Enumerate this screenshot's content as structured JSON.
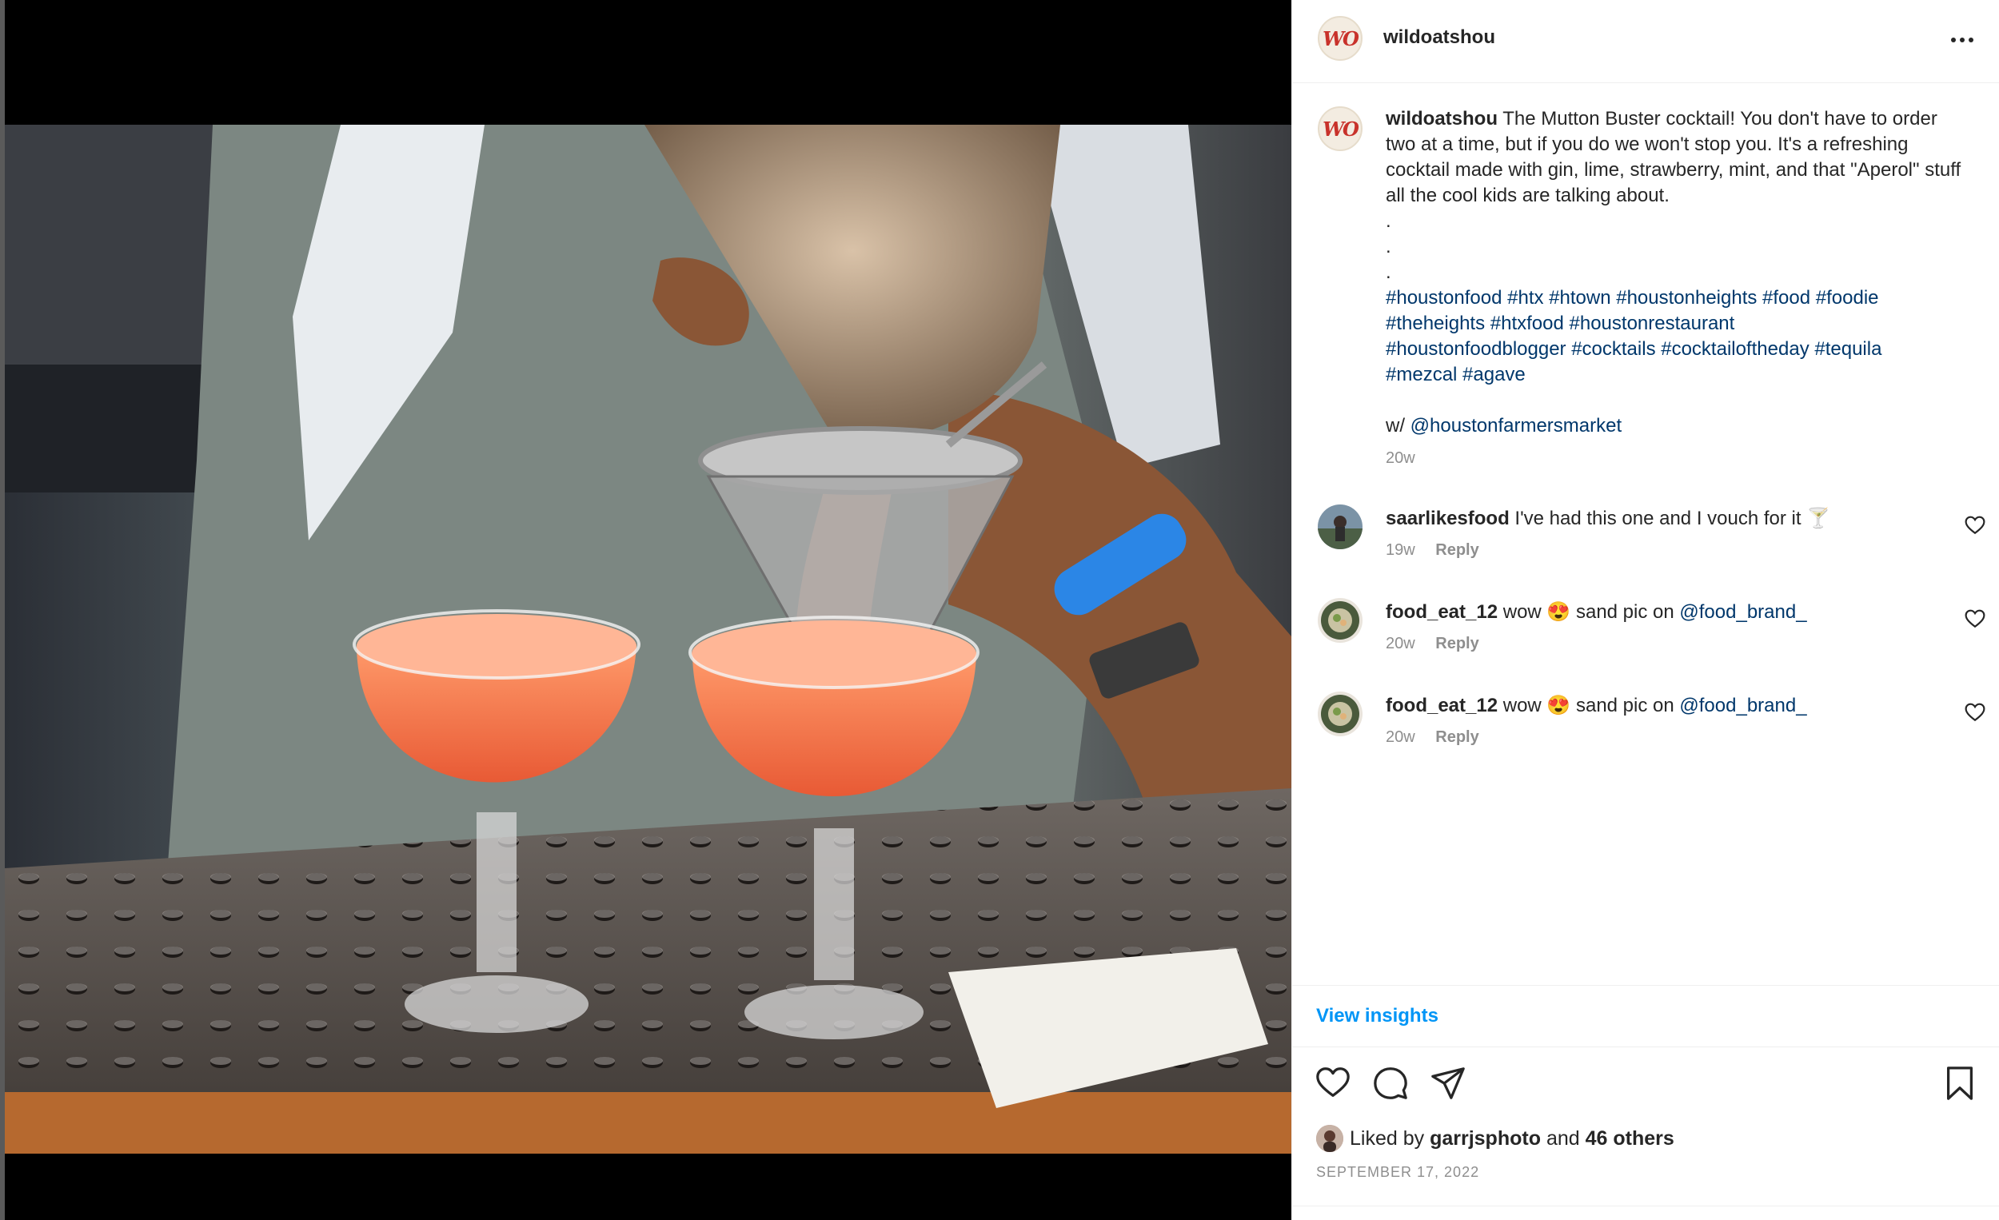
{
  "post": {
    "author": "wildoatshou",
    "avatar_monogram": "WO"
  },
  "caption": {
    "username": "wildoatshou",
    "text": "The Mutton Buster cocktail! You don't have to order two at a time, but if you do we won't stop you. It's a refreshing cocktail made with gin, lime, strawberry, mint, and that \"Aperol\" stuff all the cool kids are talking about.",
    "dots": [
      ".",
      ".",
      "."
    ],
    "hashtags_line1": "#houstonfood #htx #htown #houstonheights #food #foodie",
    "hashtags_line2": "#theheights #htxfood #houstonrestaurant",
    "hashtags_line3": "#houstonfoodblogger #cocktails #cocktailoftheday #tequila",
    "hashtags_line4": "#mezcal #agave",
    "with_prefix": "w/",
    "with_mention": "@houstonfarmersmarket",
    "time": "20w"
  },
  "comments": [
    {
      "username": "saarlikesfood",
      "text": "I've had this one and I vouch for it 🍸",
      "mention": "",
      "time": "19w",
      "reply": "Reply"
    },
    {
      "username": "food_eat_12",
      "text": "wow 😍 sand pic on",
      "mention": "@food_brand_",
      "time": "20w",
      "reply": "Reply"
    },
    {
      "username": "food_eat_12",
      "text": "wow 😍 sand pic on",
      "mention": "@food_brand_",
      "time": "20w",
      "reply": "Reply"
    }
  ],
  "insights_label": "View insights",
  "likes": {
    "prefix": "Liked by",
    "user": "garrjsphoto",
    "and": "and",
    "others": "46 others"
  },
  "date": "SEPTEMBER 17, 2022",
  "icons": {
    "more": "more-horizontal-icon",
    "like": "heart-icon",
    "comment": "comment-icon",
    "share": "paper-plane-icon",
    "save": "bookmark-icon"
  },
  "colors": {
    "link": "#00376b",
    "accent": "#0095f6",
    "muted": "#8e8e8e"
  }
}
